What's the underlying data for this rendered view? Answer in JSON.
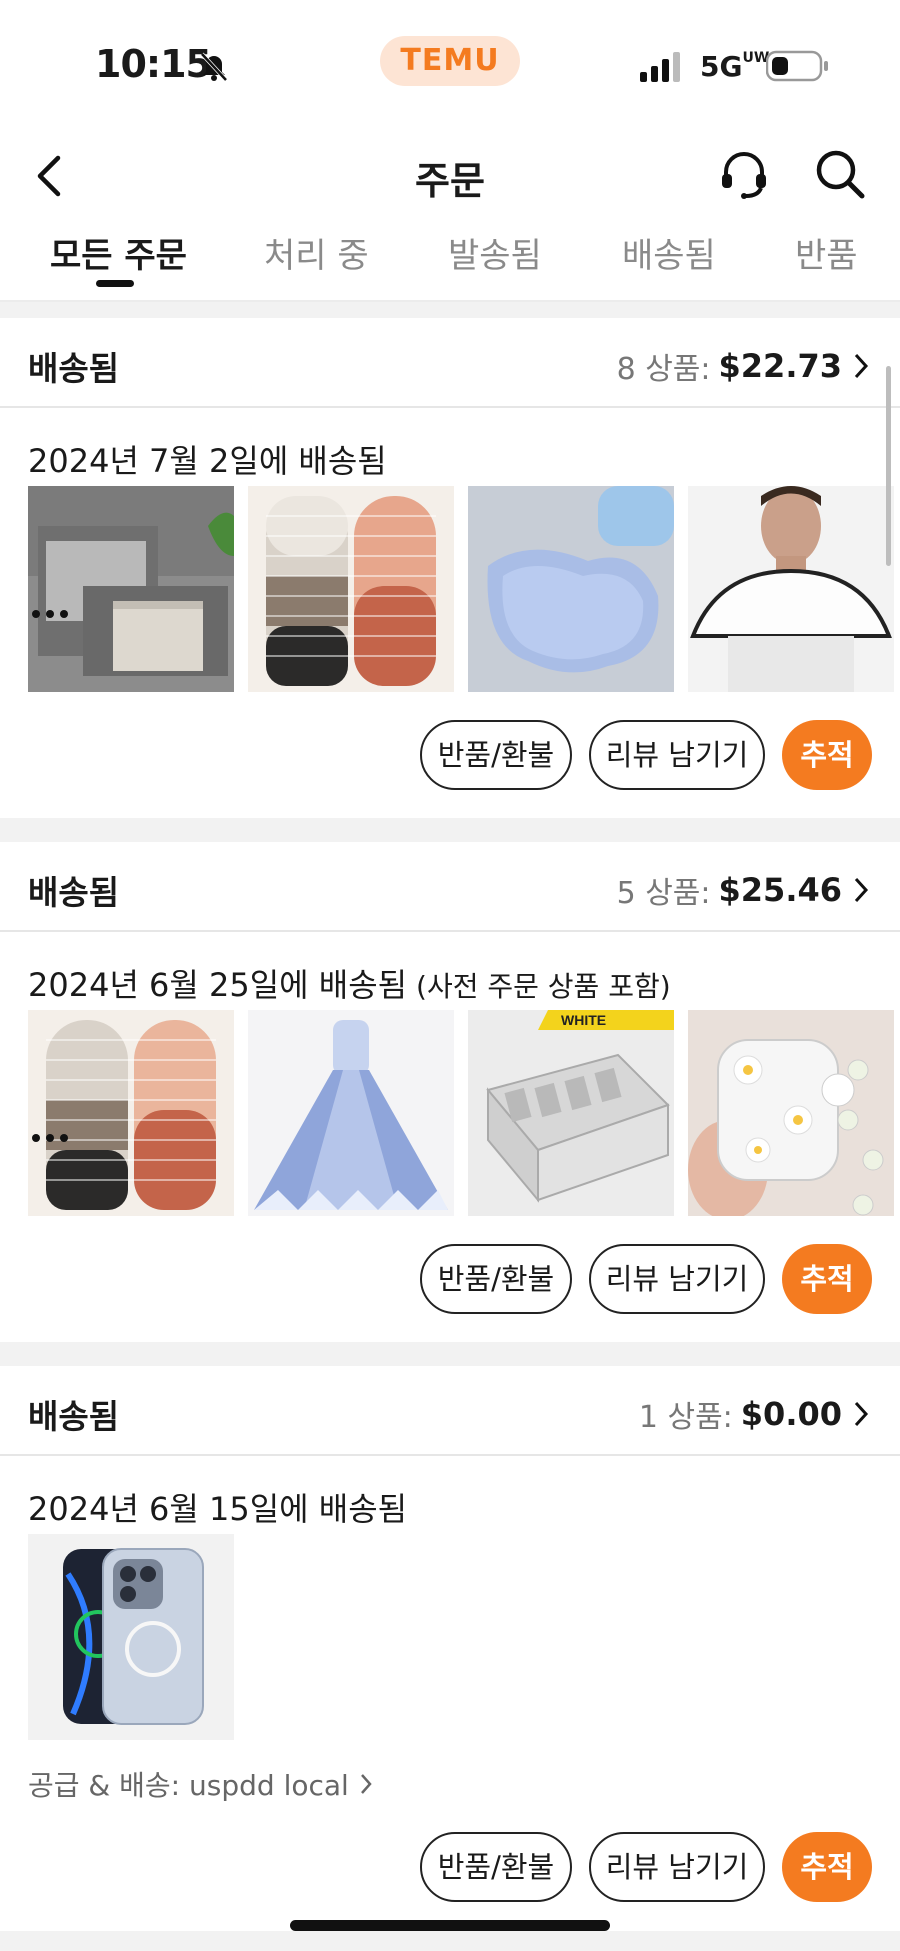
{
  "status_bar": {
    "time": "10:15",
    "brand": "TEMU",
    "network": "5G",
    "network_sub": "UW",
    "bell_icon": "bell-slash-icon",
    "signal_icon": "signal-bars-icon",
    "battery_icon": "battery-low-icon"
  },
  "nav": {
    "title": "주문",
    "back_icon": "chevron-left-icon",
    "support_icon": "headset-icon",
    "search_icon": "search-icon"
  },
  "tabs": [
    {
      "label": "모든 주문",
      "active": true
    },
    {
      "label": "처리 중",
      "active": false
    },
    {
      "label": "발송됨",
      "active": false
    },
    {
      "label": "배송됨",
      "active": false
    },
    {
      "label": "반품",
      "active": false
    }
  ],
  "orders": [
    {
      "status": "배송됨",
      "count": "8 상품:",
      "price": "$22.73",
      "date": "2024년 7월 2일에 배송됨",
      "note": "",
      "thumbnails": [
        "storage-bags",
        "coil-hair-ties",
        "foot-scrubber-mat",
        "hair-cutting-cape"
      ],
      "buttons": {
        "refund": "반품/환불",
        "review": "리뷰 남기기",
        "track": "추적"
      }
    },
    {
      "status": "배송됨",
      "count": "5 상품:",
      "price": "$25.46",
      "date": "2024년 6월 25일에 배송됨",
      "note": " (사전 주문 상품 포함)",
      "thumbnails": [
        "coil-hair-ties",
        "princess-dress",
        "drawer-organizer",
        "daisy-earbud-case"
      ],
      "thumb_badge": "WHITE",
      "buttons": {
        "refund": "반품/환불",
        "review": "리뷰 남기기",
        "track": "추적"
      }
    },
    {
      "status": "배송됨",
      "count": "1 상품:",
      "price": "$0.00",
      "date": "2024년 6월 15일에 배송됨",
      "note": "",
      "thumbnails": [
        "phone-case"
      ],
      "supplier": "공급 & 배송: uspdd local",
      "buttons": {
        "refund": "반품/환불",
        "review": "리뷰 남기기",
        "track": "추적"
      }
    }
  ],
  "colors": {
    "accent": "#f47b20",
    "brand_pill_bg": "#fde4d4",
    "page_bg": "#f2f2f2"
  }
}
